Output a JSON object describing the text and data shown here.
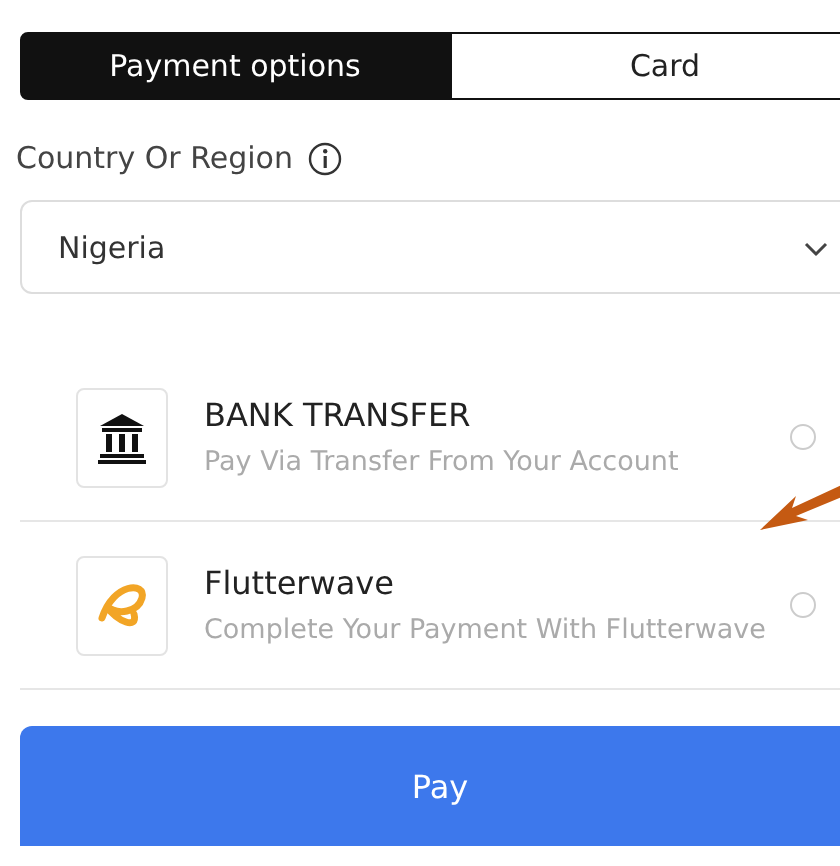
{
  "tabs": [
    {
      "label": "Payment options",
      "selected": true
    },
    {
      "label": "Card",
      "selected": false
    }
  ],
  "country": {
    "label": "Country Or Region",
    "value": "Nigeria"
  },
  "options": [
    {
      "kind": "bank",
      "title": "BANK TRANSFER",
      "subtitle": "Pay Via Transfer From Your Account",
      "selected": false
    },
    {
      "kind": "flutterwave",
      "title": "Flutterwave",
      "subtitle": "Complete Your Payment With Flutterwave",
      "selected": false
    }
  ],
  "pay_button": "Pay"
}
